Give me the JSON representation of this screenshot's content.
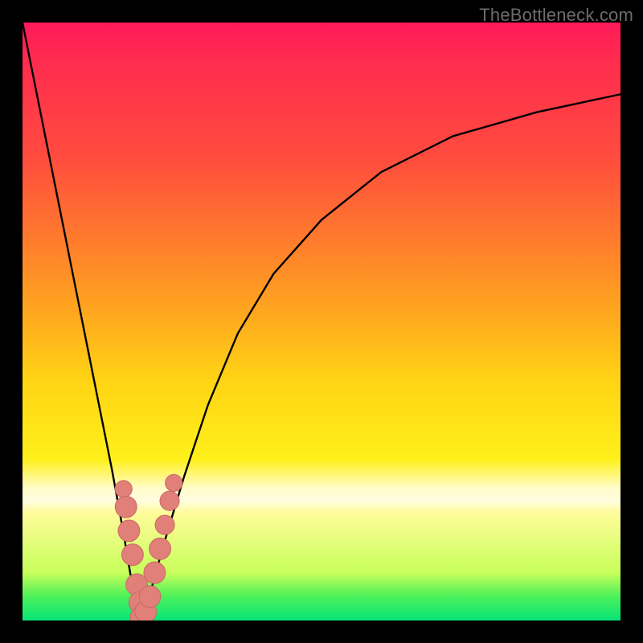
{
  "watermark": {
    "text": "TheBottleneck.com"
  },
  "colors": {
    "frame": "#000000",
    "curve": "#000000",
    "marker_fill": "#e08079",
    "marker_stroke": "#c96a63"
  },
  "chart_data": {
    "type": "line",
    "title": "",
    "xlabel": "",
    "ylabel": "",
    "xlim": [
      0,
      100
    ],
    "ylim": [
      0,
      100
    ],
    "grid": false,
    "legend": false,
    "note": "Values are estimated from pixel positions; axes and ticks are not shown in the source image.",
    "series": [
      {
        "name": "bottleneck-curve",
        "x": [
          0,
          3,
          6,
          9,
          12,
          15,
          17,
          18,
          19,
          19.5,
          20,
          20.5,
          21,
          22,
          24,
          27,
          31,
          36,
          42,
          50,
          60,
          72,
          86,
          100
        ],
        "y": [
          100,
          85,
          70,
          55,
          40,
          25,
          14,
          8,
          3,
          1,
          0,
          1,
          3,
          7,
          14,
          24,
          36,
          48,
          58,
          67,
          75,
          81,
          85,
          88
        ]
      }
    ],
    "markers": [
      {
        "x": 16.9,
        "y": 22,
        "r": 1.5
      },
      {
        "x": 17.3,
        "y": 19,
        "r": 1.9
      },
      {
        "x": 17.8,
        "y": 15,
        "r": 1.9
      },
      {
        "x": 18.4,
        "y": 11,
        "r": 1.9
      },
      {
        "x": 19.1,
        "y": 6,
        "r": 1.9
      },
      {
        "x": 19.6,
        "y": 3,
        "r": 1.9
      },
      {
        "x": 20.0,
        "y": 0.5,
        "r": 2.1
      },
      {
        "x": 20.6,
        "y": 1.5,
        "r": 1.9
      },
      {
        "x": 21.3,
        "y": 4,
        "r": 1.9
      },
      {
        "x": 22.1,
        "y": 8,
        "r": 1.9
      },
      {
        "x": 23.0,
        "y": 12,
        "r": 1.9
      },
      {
        "x": 23.8,
        "y": 16,
        "r": 1.7
      },
      {
        "x": 24.6,
        "y": 20,
        "r": 1.7
      },
      {
        "x": 25.3,
        "y": 23,
        "r": 1.5
      }
    ]
  }
}
